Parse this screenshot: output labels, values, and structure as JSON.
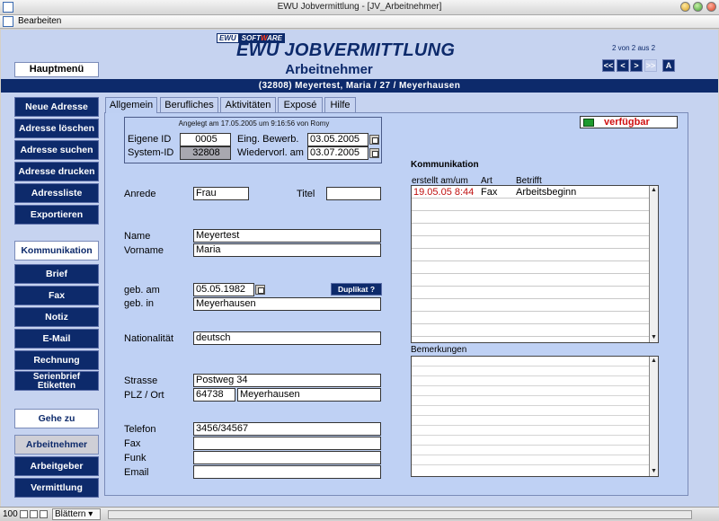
{
  "window": {
    "title": "EWU Jobvermittlung - [JV_Arbeitnehmer]",
    "menu": "Bearbeiten"
  },
  "brand": {
    "part1": "EWU",
    "part2a": "SOFT",
    "part2b": "W",
    "part2c": "ARE",
    "title": "EWU JOBVERMITTLUNG",
    "subtitle": "Arbeitnehmer"
  },
  "pager": {
    "text": "2 von 2 aus 2",
    "first": "<<",
    "prev": "<",
    "next": ">",
    "last": ">>",
    "a": "A"
  },
  "record": "(32808) Meyertest, Maria / 27 / Meyerhausen",
  "sidebar": {
    "hauptmenu": "Hauptmenü",
    "group1": [
      "Neue Adresse",
      "Adresse löschen",
      "Adresse suchen",
      "Adresse drucken",
      "Adressliste",
      "Exportieren"
    ],
    "kommunikation": "Kommunikation",
    "group2": [
      "Brief",
      "Fax",
      "Notiz",
      "E-Mail",
      "Rechnung"
    ],
    "serienbrief1": "Serienbrief",
    "serienbrief2": "Etiketten",
    "gehezu": "Gehe zu",
    "group3": [
      "Arbeitnehmer",
      "Arbeitgeber",
      "Vermittlung"
    ]
  },
  "tabs": [
    "Allgemein",
    "Berufliches",
    "Aktivitäten",
    "Exposé",
    "Hilfe"
  ],
  "idbox": {
    "caption": "Angelegt am 17.05.2005 um 9:16:56 von Romy",
    "eigene_id_label": "Eigene ID",
    "eigene_id": "0005",
    "system_id_label": "System-ID",
    "system_id": "32808",
    "bewerb_label": "Eing. Bewerb.",
    "bewerb": "03.05.2005",
    "wiedervorl_label": "Wiedervorl. am",
    "wiedervorl": "03.07.2005"
  },
  "form": {
    "anrede_label": "Anrede",
    "anrede": "Frau",
    "titel_label": "Titel",
    "titel": "",
    "name_label": "Name",
    "name": "Meyertest",
    "vorname_label": "Vorname",
    "vorname": "Maria",
    "gebam_label": "geb. am",
    "gebam": "05.05.1982",
    "duplikat": "Duplikat ?",
    "gebin_label": "geb. in",
    "gebin": "Meyerhausen",
    "nat_label": "Nationalität",
    "nat": "deutsch",
    "strasse_label": "Strasse",
    "strasse": "Postweg 34",
    "plz_label": "PLZ / Ort",
    "plz": "64738",
    "ort": "Meyerhausen",
    "telefon_label": "Telefon",
    "telefon": "3456/34567",
    "fax_label": "Fax",
    "fax": "",
    "funk_label": "Funk",
    "funk": "",
    "email_label": "Email",
    "email": ""
  },
  "status": {
    "text": "verfügbar",
    "color": "#1e9a2e"
  },
  "kommunikation": {
    "title": "Kommunikation",
    "col_date": "erstellt am/um",
    "col_art": "Art",
    "col_betrifft": "Betrifft",
    "rows": [
      {
        "date": "19.05.05 8:44",
        "art": "Fax",
        "betrifft": "Arbeitsbeginn"
      }
    ]
  },
  "bemerkungen": {
    "title": "Bemerkungen"
  },
  "statusbar": {
    "zoom": "100",
    "mode": "Blättern"
  }
}
